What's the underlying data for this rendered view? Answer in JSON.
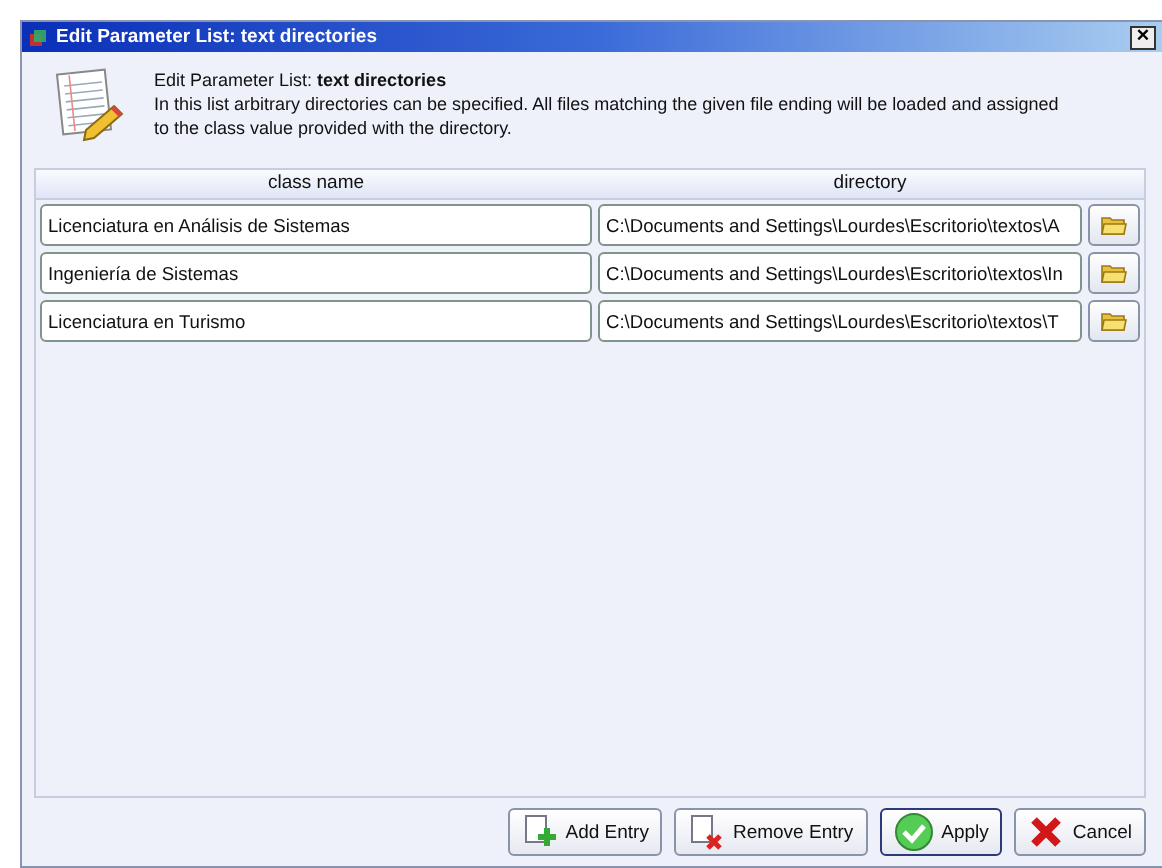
{
  "window": {
    "title": "Edit Parameter List: text directories",
    "close": "×"
  },
  "header": {
    "title": "Edit Parameter List: **text directories**",
    "description": "In this list arbitrary directories can be specified. All files matching the given file ending will be loaded and assigned to the class value provided with the directory."
  },
  "table": {
    "columns": [
      "class name",
      "directory"
    ],
    "rows": [
      {
        "class_name": "Licenciatura en Análisis de Sistemas",
        "directory": "C:\\Documents and Settings\\Lourdes\\Escritorio\\textos\\A"
      },
      {
        "class_name": "Ingeniería de Sistemas",
        "directory": "C:\\Documents and Settings\\Lourdes\\Escritorio\\textos\\In"
      },
      {
        "class_name": "Licenciatura en Turismo",
        "directory": "C:\\Documents and Settings\\Lourdes\\Escritorio\\textos\\T"
      }
    ]
  },
  "buttons": [
    {
      "kind": "add",
      "label": "Add Entry",
      "focused": false
    },
    {
      "kind": "remove",
      "label": "Remove Entry",
      "focused": false
    },
    {
      "kind": "apply",
      "label": "Apply",
      "focused": true
    },
    {
      "kind": "cancel",
      "label": "Cancel",
      "focused": false
    }
  ]
}
